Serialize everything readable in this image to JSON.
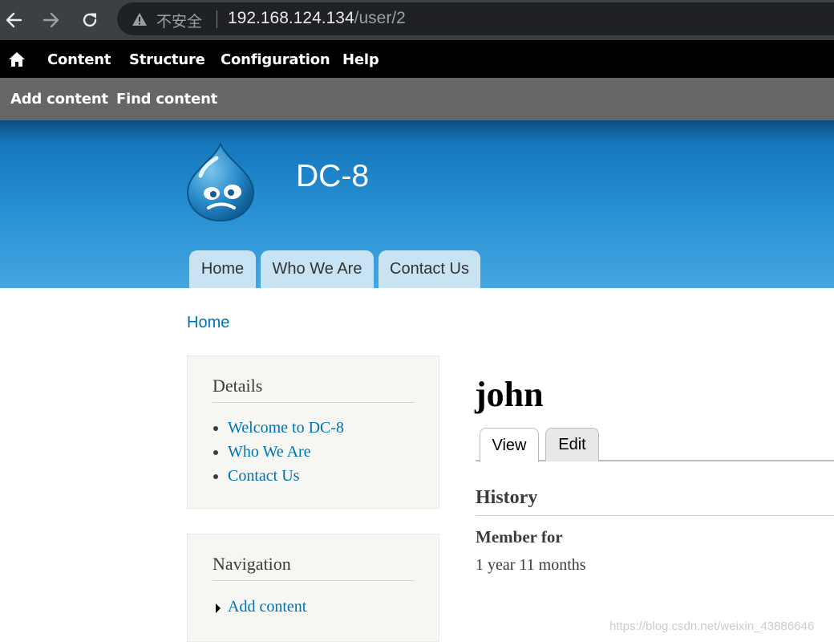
{
  "browser": {
    "security_label": "不安全",
    "url_host": "192.168.124.134",
    "url_path": "/user/2"
  },
  "toolbar": {
    "items": [
      "Content",
      "Structure",
      "Configuration",
      "Help"
    ]
  },
  "shortcuts": {
    "items": [
      "Add content",
      "Find content"
    ]
  },
  "site": {
    "name": "DC-8",
    "tabs": [
      "Home",
      "Who We Are",
      "Contact Us"
    ]
  },
  "breadcrumb": "Home",
  "sidebar": {
    "details": {
      "title": "Details",
      "links": [
        "Welcome to DC-8",
        "Who We Are",
        "Contact Us"
      ]
    },
    "navigation": {
      "title": "Navigation",
      "links": [
        "Add content"
      ]
    }
  },
  "page": {
    "title": "john",
    "tabs": [
      "View",
      "Edit"
    ],
    "history_title": "History",
    "member_label": "Member for",
    "member_value": "1 year 11 months"
  },
  "watermark": "https://blog.csdn.net/weixin_43886646",
  "colors": {
    "link": "#0071b3",
    "toolbar": "#000000",
    "shortcuts": "#666666",
    "header_top": "#1677bd",
    "header_bottom": "#45a6e0",
    "tab_bg": "#c7e3f4"
  }
}
